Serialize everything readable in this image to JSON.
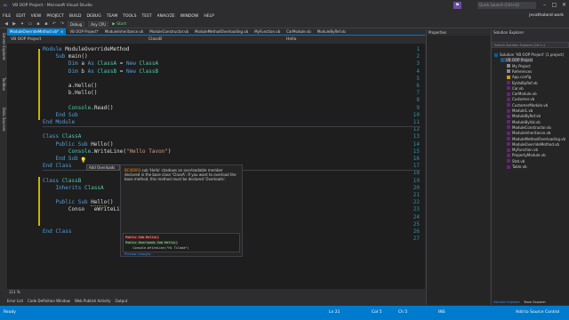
{
  "window": {
    "title": "VB OOP Project - Microsoft Visual Studio",
    "quick_launch_placeholder": "Quick Launch (Ctrl+Q)",
    "user": "jevathaland work"
  },
  "menu": [
    "FILE",
    "EDIT",
    "VIEW",
    "PROJECT",
    "BUILD",
    "DEBUG",
    "TEAM",
    "TOOLS",
    "TEST",
    "ANALYZE",
    "WINDOW",
    "HELP"
  ],
  "toolbar": {
    "config": "Debug",
    "platform": "Any CPU",
    "start_label": "Start"
  },
  "left_rail": [
    "Server Explorer",
    "Toolbox",
    "Data Sources"
  ],
  "doc_tabs": [
    {
      "label": "ModuleOverrideMethod.vb*",
      "active": true
    },
    {
      "label": "VB OOP Project*",
      "active": false
    },
    {
      "label": "ModuleInheritance.vb",
      "active": false
    },
    {
      "label": "ModuleConstructor.vb",
      "active": false
    },
    {
      "label": "ModuleMethodOverloading.vb",
      "active": false
    },
    {
      "label": "MyFunction.vb",
      "active": false
    },
    {
      "label": "CarModule.vb",
      "active": false
    },
    {
      "label": "ModuleByRef.vb",
      "active": false
    }
  ],
  "nav": {
    "project": "VB OOP Project",
    "class": "ClassB",
    "member": "Hello"
  },
  "code_lines": [
    {
      "n": "1",
      "html": "<span class='kw'>Module</span> ModuleOverrideMethod"
    },
    {
      "n": "2",
      "html": "    <span class='kw'>Sub</span> main()"
    },
    {
      "n": "3",
      "html": "        <span class='kw'>Dim</span> a <span class='kw'>As</span> <span class='cls'>ClassA</span> = <span class='kw'>New</span> <span class='cls'>ClassA</span>"
    },
    {
      "n": "4",
      "html": "        <span class='kw'>Dim</span> b <span class='kw'>As</span> <span class='cls'>ClassB</span> = <span class='kw'>New</span> <span class='cls'>ClassB</span>"
    },
    {
      "n": "5",
      "html": ""
    },
    {
      "n": "6",
      "html": "        a.Hello()"
    },
    {
      "n": "7",
      "html": "        b.Hello()"
    },
    {
      "n": "8",
      "html": ""
    },
    {
      "n": "9",
      "html": "        <span class='cls'>Console</span>.Read()"
    },
    {
      "n": "10",
      "html": "    <span class='kw'>End Sub</span>"
    },
    {
      "n": "11",
      "html": "<span class='kw'>End Module</span>"
    },
    {
      "n": "12",
      "html": ""
    },
    {
      "n": "13",
      "html": "<span class='kw'>Class</span> <span class='cls'>ClassA</span>"
    },
    {
      "n": "14",
      "html": "    <span class='kw'>Public Sub</span> Hello()"
    },
    {
      "n": "15",
      "html": "        <span class='cls'>Console</span>.WriteLine(<span class='str'>\"Hello Tavon\"</span>)"
    },
    {
      "n": "16",
      "html": "    <span class='kw'>End Sub</span>"
    },
    {
      "n": "17",
      "html": "<span class='kw'>End Class</span>"
    },
    {
      "n": "18",
      "html": ""
    },
    {
      "n": "19",
      "html": "<span class='kw'>Class</span> <span class='cls'>ClassB</span>"
    },
    {
      "n": "20",
      "html": "    <span class='kw'>Inherits</span> <span class='cls'>ClassA</span>"
    },
    {
      "n": "21",
      "html": ""
    },
    {
      "n": "22",
      "html": "    <span class='kw'>Public Sub</span> <span class='squiggle'>Hello</span>()"
    },
    {
      "n": "23",
      "html": "        Conso   eWriteLine(<span class='str'>\"Hi Tilada\"</span>)"
    },
    {
      "n": "24",
      "html": ""
    },
    {
      "n": "25",
      "html": ""
    },
    {
      "n": "26",
      "html": "<span class='kw'>End Class</span>"
    },
    {
      "n": "27",
      "html": ""
    }
  ],
  "lightbulb": {
    "label": "Add Overloads"
  },
  "popup": {
    "code": "BC40003",
    "message": "sub 'Hello' shadows an overloadable member declared in the base class 'ClassA'.  If you want to overload the base method, this method must be declared 'Overloads'.",
    "preview_lines": [
      {
        "text": "Public Sub Hello()",
        "kind": "normal"
      },
      {
        "text": "Public Overloads Sub Hello()",
        "kind": "add"
      },
      {
        "text": "    Console.WriteLine(\"Hi Tilada\")",
        "kind": "normal"
      }
    ],
    "preview_link": "Preview changes"
  },
  "properties_panel": {
    "title": "Properties"
  },
  "solution_explorer": {
    "title": "Solution Explorer",
    "search_placeholder": "Search Solution Explorer (Ctrl+;)",
    "items": [
      {
        "label": "Solution 'VB OOP Project' (1 project)",
        "indent": 0,
        "icon": "proj",
        "selected": false
      },
      {
        "label": "VB OOP Project",
        "indent": 1,
        "icon": "proj",
        "selected": true
      },
      {
        "label": "My Project",
        "indent": 2,
        "icon": "ref",
        "selected": false
      },
      {
        "label": "References",
        "indent": 2,
        "icon": "ref",
        "selected": false
      },
      {
        "label": "App.config",
        "indent": 2,
        "icon": "cfg",
        "selected": false
      },
      {
        "label": "ByValByRef.vb",
        "indent": 2,
        "icon": "vb",
        "selected": false
      },
      {
        "label": "Car.vb",
        "indent": 2,
        "icon": "vb",
        "selected": false
      },
      {
        "label": "CarModule.vb",
        "indent": 2,
        "icon": "vb",
        "selected": false
      },
      {
        "label": "Customer.vb",
        "indent": 2,
        "icon": "vb",
        "selected": false
      },
      {
        "label": "CustomerModule.vb",
        "indent": 2,
        "icon": "vb",
        "selected": false
      },
      {
        "label": "Module1.vb",
        "indent": 2,
        "icon": "vb",
        "selected": false
      },
      {
        "label": "ModuleByRef.vb",
        "indent": 2,
        "icon": "vb",
        "selected": false
      },
      {
        "label": "ModuleByVal.vb",
        "indent": 2,
        "icon": "vb",
        "selected": false
      },
      {
        "label": "ModuleConstructor.vb",
        "indent": 2,
        "icon": "vb",
        "selected": false
      },
      {
        "label": "ModuleInheritance.vb",
        "indent": 2,
        "icon": "vb",
        "selected": false
      },
      {
        "label": "ModuleMethodOverloading.vb",
        "indent": 2,
        "icon": "vb",
        "selected": false
      },
      {
        "label": "ModuleOverrideMethod.vb",
        "indent": 2,
        "icon": "vb",
        "selected": false
      },
      {
        "label": "MyFunction.vb",
        "indent": 2,
        "icon": "vb",
        "selected": false
      },
      {
        "label": "PropertyModule.vb",
        "indent": 2,
        "icon": "vb",
        "selected": false
      },
      {
        "label": "Stat.vb",
        "indent": 2,
        "icon": "vb",
        "selected": false
      },
      {
        "label": "Table.vb",
        "indent": 2,
        "icon": "vb",
        "selected": false
      }
    ],
    "bottom_tabs": [
      "Solution Explorer",
      "Team Explorer"
    ]
  },
  "zoom": "111 %",
  "bottom_tabs": [
    "Error List",
    "Code Definition Window",
    "Web Publish Activity",
    "Output"
  ],
  "status": {
    "state": "Ready",
    "line": "Ln 21",
    "col": "Col 5",
    "ch": "Ch 5",
    "mode": "INS",
    "source_control": "Add to Source Control"
  }
}
